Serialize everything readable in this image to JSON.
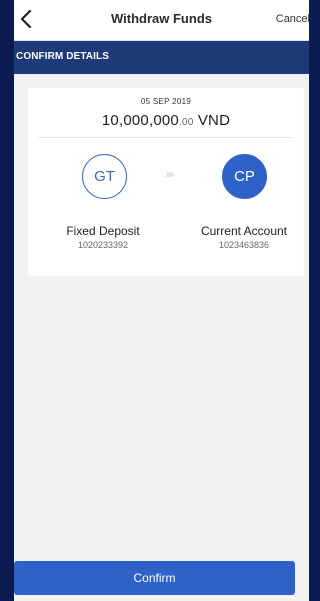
{
  "header": {
    "title": "Withdraw Funds",
    "cancel_label": "Cancel",
    "back_icon": "chevron-left-icon"
  },
  "section": {
    "title": "CONFIRM DETAILS"
  },
  "transfer": {
    "date": "05 SEP 2019",
    "amount_whole": "10,000,000",
    "amount_decimal": ".00",
    "currency": "VND",
    "from": {
      "initials": "GT",
      "name": "Fixed Deposit",
      "number": "1020233392"
    },
    "arrows_text": "››››",
    "to": {
      "initials": "CP",
      "name": "Current Account",
      "number": "1023463836"
    }
  },
  "footer": {
    "confirm_label": "Confirm"
  },
  "colors": {
    "navy_frame": "#0b1a4f",
    "section_blue": "#1e3a78",
    "accent_blue": "#2f62c9"
  }
}
